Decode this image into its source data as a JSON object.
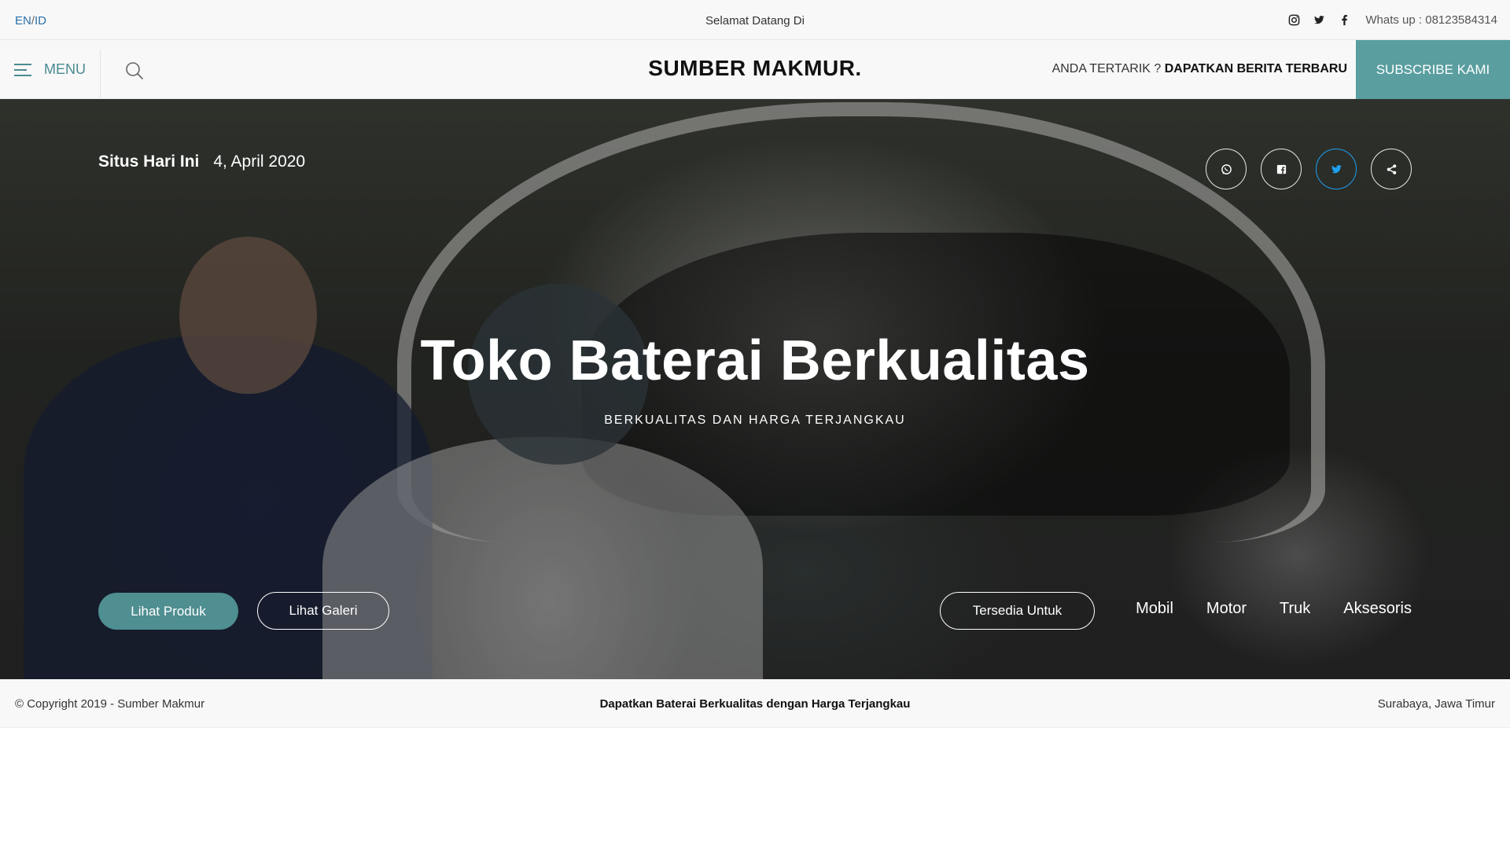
{
  "topbar": {
    "lang_en": "EN",
    "lang_sep": "/",
    "lang_id": "ID",
    "welcome": "Selamat Datang Di",
    "social_icons": [
      "instagram-icon",
      "twitter-icon",
      "facebook-icon"
    ],
    "whatsapp": "Whats up : 08123584314"
  },
  "header": {
    "menu_label": "MENU",
    "logo": "SUMBER MAKMUR.",
    "interest_prefix": "ANDA TERTARIK ? ",
    "interest_strong": "DAPATKAN BERITA TERBARU",
    "subscribe_label": "SUBSCRIBE KAMI",
    "accent_color": "#5a9ea0"
  },
  "hero": {
    "date_label": "Situs Hari Ini",
    "date_value": "4, April 2020",
    "share_icons": [
      "whatsapp-icon",
      "facebook-icon",
      "twitter-icon",
      "share-icon"
    ],
    "title": "Toko Baterai Berkualitas",
    "subtitle": "BERKUALITAS DAN HARGA TERJANGKAU",
    "btn_products": "Lihat Produk",
    "btn_gallery": "Lihat Galeri",
    "btn_available": "Tersedia Untuk",
    "categories": [
      "Mobil",
      "Motor",
      "Truk",
      "Aksesoris"
    ]
  },
  "footer": {
    "copyright": "© Copyright 2019 - Sumber Makmur",
    "tagline": "Dapatkan Baterai Berkualitas dengan Harga Terjangkau",
    "location": "Surabaya, Jawa Timur"
  }
}
